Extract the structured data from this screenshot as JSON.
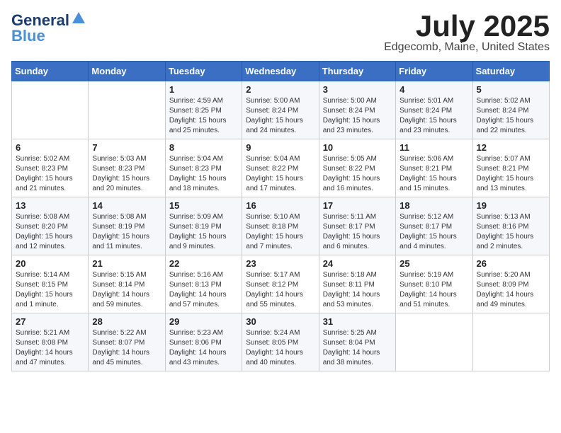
{
  "logo": {
    "line1": "General",
    "line2": "Blue"
  },
  "title": "July 2025",
  "subtitle": "Edgecomb, Maine, United States",
  "weekdays": [
    "Sunday",
    "Monday",
    "Tuesday",
    "Wednesday",
    "Thursday",
    "Friday",
    "Saturday"
  ],
  "weeks": [
    [
      {
        "day": "",
        "info": ""
      },
      {
        "day": "",
        "info": ""
      },
      {
        "day": "1",
        "info": "Sunrise: 4:59 AM\nSunset: 8:25 PM\nDaylight: 15 hours\nand 25 minutes."
      },
      {
        "day": "2",
        "info": "Sunrise: 5:00 AM\nSunset: 8:24 PM\nDaylight: 15 hours\nand 24 minutes."
      },
      {
        "day": "3",
        "info": "Sunrise: 5:00 AM\nSunset: 8:24 PM\nDaylight: 15 hours\nand 23 minutes."
      },
      {
        "day": "4",
        "info": "Sunrise: 5:01 AM\nSunset: 8:24 PM\nDaylight: 15 hours\nand 23 minutes."
      },
      {
        "day": "5",
        "info": "Sunrise: 5:02 AM\nSunset: 8:24 PM\nDaylight: 15 hours\nand 22 minutes."
      }
    ],
    [
      {
        "day": "6",
        "info": "Sunrise: 5:02 AM\nSunset: 8:23 PM\nDaylight: 15 hours\nand 21 minutes."
      },
      {
        "day": "7",
        "info": "Sunrise: 5:03 AM\nSunset: 8:23 PM\nDaylight: 15 hours\nand 20 minutes."
      },
      {
        "day": "8",
        "info": "Sunrise: 5:04 AM\nSunset: 8:23 PM\nDaylight: 15 hours\nand 18 minutes."
      },
      {
        "day": "9",
        "info": "Sunrise: 5:04 AM\nSunset: 8:22 PM\nDaylight: 15 hours\nand 17 minutes."
      },
      {
        "day": "10",
        "info": "Sunrise: 5:05 AM\nSunset: 8:22 PM\nDaylight: 15 hours\nand 16 minutes."
      },
      {
        "day": "11",
        "info": "Sunrise: 5:06 AM\nSunset: 8:21 PM\nDaylight: 15 hours\nand 15 minutes."
      },
      {
        "day": "12",
        "info": "Sunrise: 5:07 AM\nSunset: 8:21 PM\nDaylight: 15 hours\nand 13 minutes."
      }
    ],
    [
      {
        "day": "13",
        "info": "Sunrise: 5:08 AM\nSunset: 8:20 PM\nDaylight: 15 hours\nand 12 minutes."
      },
      {
        "day": "14",
        "info": "Sunrise: 5:08 AM\nSunset: 8:19 PM\nDaylight: 15 hours\nand 11 minutes."
      },
      {
        "day": "15",
        "info": "Sunrise: 5:09 AM\nSunset: 8:19 PM\nDaylight: 15 hours\nand 9 minutes."
      },
      {
        "day": "16",
        "info": "Sunrise: 5:10 AM\nSunset: 8:18 PM\nDaylight: 15 hours\nand 7 minutes."
      },
      {
        "day": "17",
        "info": "Sunrise: 5:11 AM\nSunset: 8:17 PM\nDaylight: 15 hours\nand 6 minutes."
      },
      {
        "day": "18",
        "info": "Sunrise: 5:12 AM\nSunset: 8:17 PM\nDaylight: 15 hours\nand 4 minutes."
      },
      {
        "day": "19",
        "info": "Sunrise: 5:13 AM\nSunset: 8:16 PM\nDaylight: 15 hours\nand 2 minutes."
      }
    ],
    [
      {
        "day": "20",
        "info": "Sunrise: 5:14 AM\nSunset: 8:15 PM\nDaylight: 15 hours\nand 1 minute."
      },
      {
        "day": "21",
        "info": "Sunrise: 5:15 AM\nSunset: 8:14 PM\nDaylight: 14 hours\nand 59 minutes."
      },
      {
        "day": "22",
        "info": "Sunrise: 5:16 AM\nSunset: 8:13 PM\nDaylight: 14 hours\nand 57 minutes."
      },
      {
        "day": "23",
        "info": "Sunrise: 5:17 AM\nSunset: 8:12 PM\nDaylight: 14 hours\nand 55 minutes."
      },
      {
        "day": "24",
        "info": "Sunrise: 5:18 AM\nSunset: 8:11 PM\nDaylight: 14 hours\nand 53 minutes."
      },
      {
        "day": "25",
        "info": "Sunrise: 5:19 AM\nSunset: 8:10 PM\nDaylight: 14 hours\nand 51 minutes."
      },
      {
        "day": "26",
        "info": "Sunrise: 5:20 AM\nSunset: 8:09 PM\nDaylight: 14 hours\nand 49 minutes."
      }
    ],
    [
      {
        "day": "27",
        "info": "Sunrise: 5:21 AM\nSunset: 8:08 PM\nDaylight: 14 hours\nand 47 minutes."
      },
      {
        "day": "28",
        "info": "Sunrise: 5:22 AM\nSunset: 8:07 PM\nDaylight: 14 hours\nand 45 minutes."
      },
      {
        "day": "29",
        "info": "Sunrise: 5:23 AM\nSunset: 8:06 PM\nDaylight: 14 hours\nand 43 minutes."
      },
      {
        "day": "30",
        "info": "Sunrise: 5:24 AM\nSunset: 8:05 PM\nDaylight: 14 hours\nand 40 minutes."
      },
      {
        "day": "31",
        "info": "Sunrise: 5:25 AM\nSunset: 8:04 PM\nDaylight: 14 hours\nand 38 minutes."
      },
      {
        "day": "",
        "info": ""
      },
      {
        "day": "",
        "info": ""
      }
    ]
  ]
}
